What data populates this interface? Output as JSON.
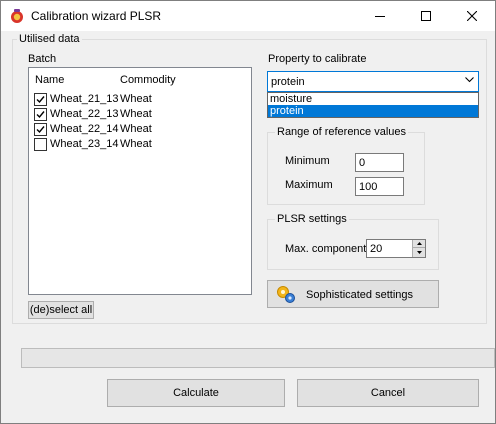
{
  "window": {
    "title": "Calibration wizard PLSR",
    "icons": {
      "app": "app-icon",
      "minimize": "minimize-icon",
      "maximize": "maximize-icon",
      "close": "close-icon"
    }
  },
  "utilised_group": {
    "label": "Utilised data"
  },
  "batch": {
    "label": "Batch",
    "columns": [
      "Name",
      "Commodity"
    ],
    "rows": [
      {
        "name": "Wheat_21_13",
        "commodity": "Wheat",
        "checked": true
      },
      {
        "name": "Wheat_22_13",
        "commodity": "Wheat",
        "checked": true
      },
      {
        "name": "Wheat_22_14",
        "commodity": "Wheat",
        "checked": true
      },
      {
        "name": "Wheat_23_14",
        "commodity": "Wheat",
        "checked": false
      }
    ],
    "deselect_label": "(de)select all"
  },
  "property": {
    "label": "Property to calibrate",
    "selected": "protein",
    "options": [
      "moisture",
      "protein"
    ]
  },
  "range": {
    "label": "Range of reference values",
    "minimum_label": "Minimum",
    "minimum_value": "0",
    "maximum_label": "Maximum",
    "maximum_value": "100"
  },
  "plsr": {
    "label": "PLSR settings",
    "max_components_label": "Max. components",
    "max_components_value": "20"
  },
  "sophisticated": {
    "label": "Sophisticated settings",
    "icon": "gears-icon"
  },
  "progress": {
    "value": 0
  },
  "footer": {
    "calculate_label": "Calculate",
    "cancel_label": "Cancel"
  }
}
